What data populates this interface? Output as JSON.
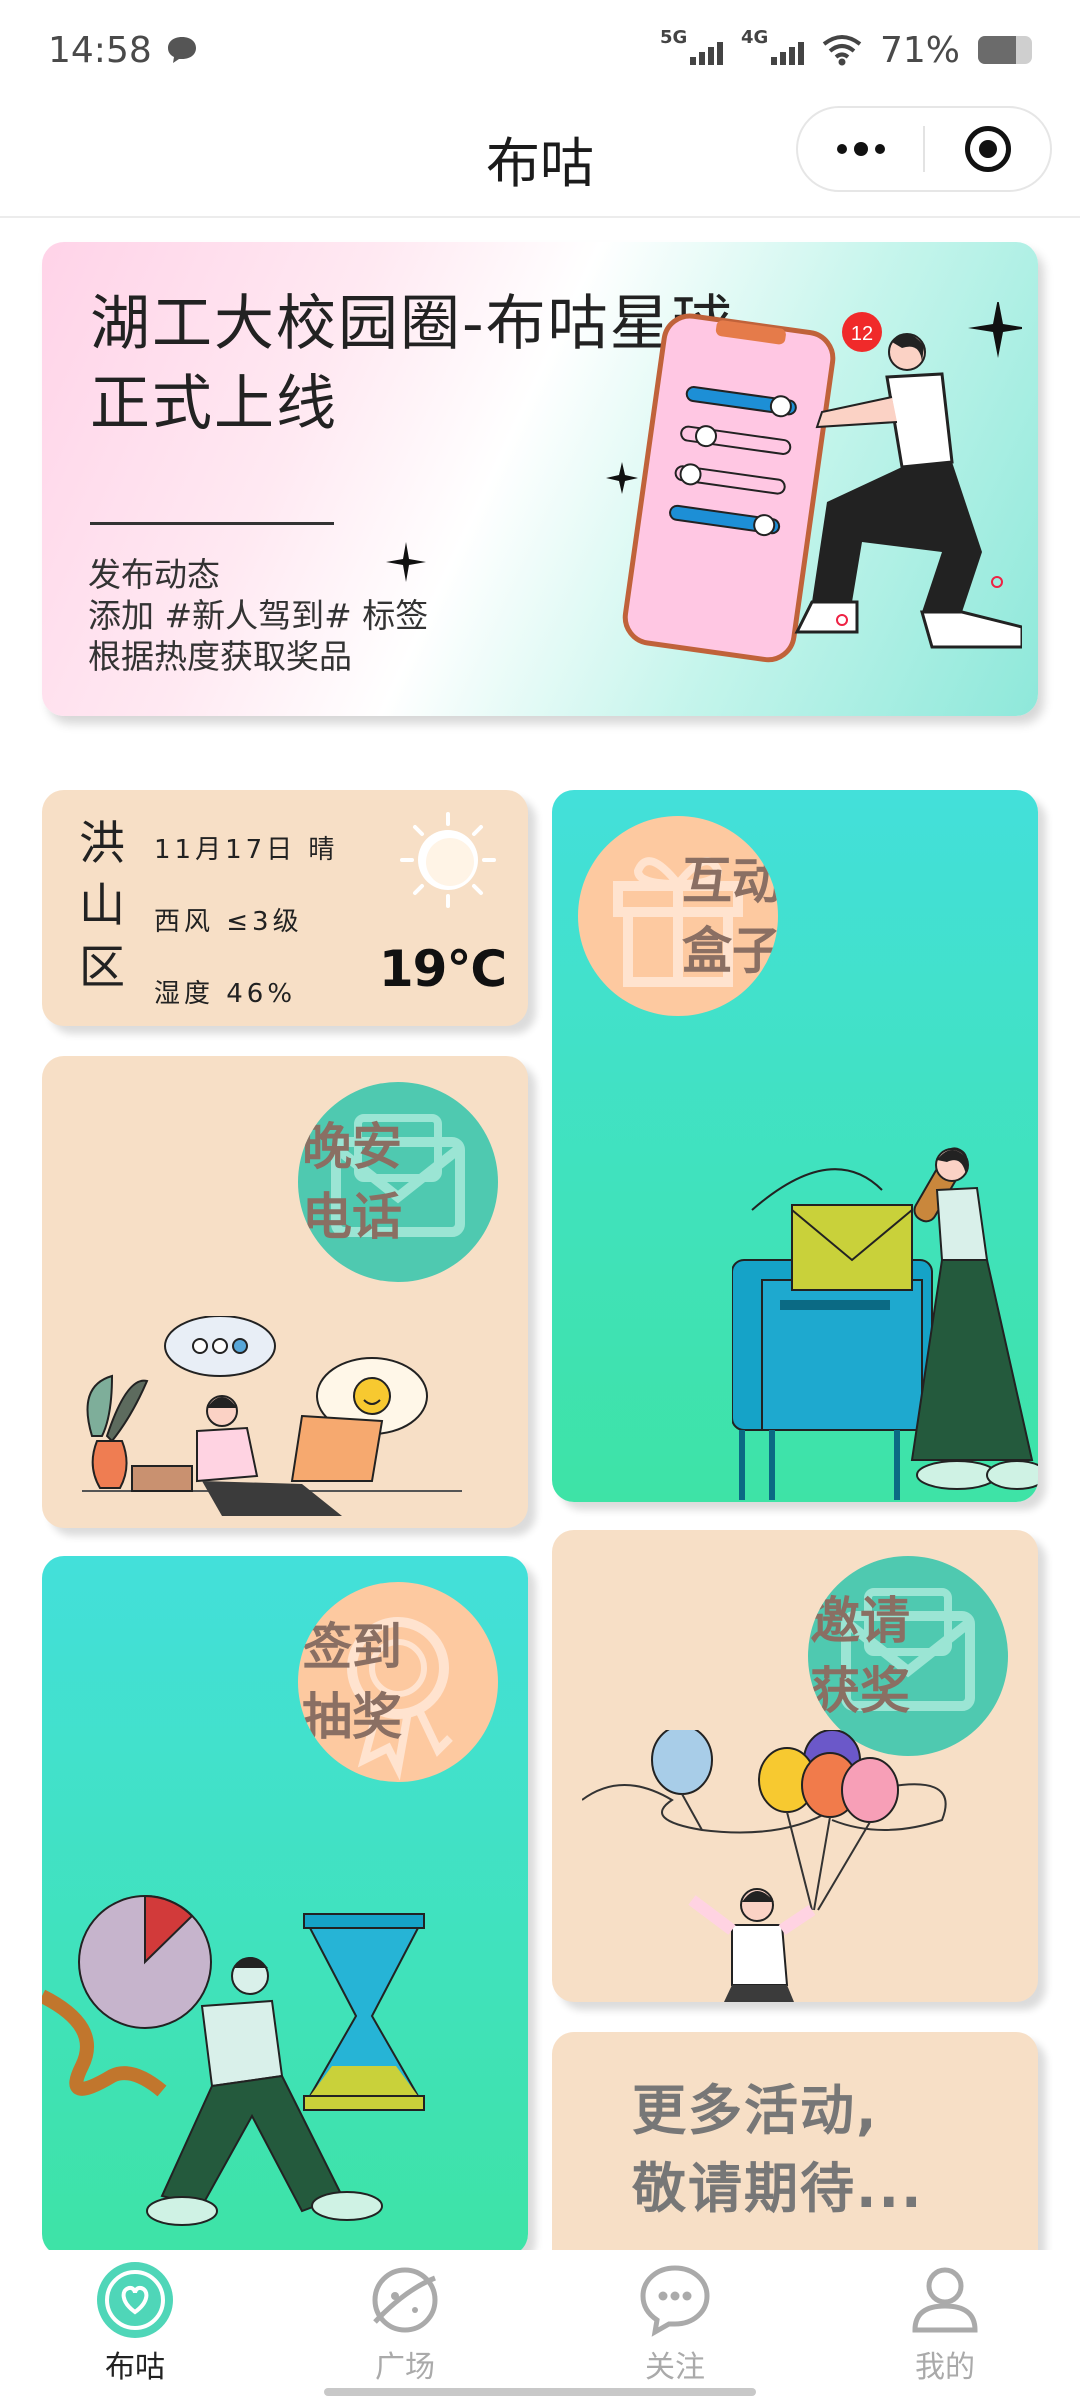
{
  "status": {
    "time": "14:58",
    "net1": "5G",
    "net2": "4G",
    "battery": "71%"
  },
  "nav": {
    "title": "布咕"
  },
  "banner": {
    "title_line1": "湖工大校园圈-布咕星球",
    "title_line2": "正式上线",
    "desc": [
      "发布动态",
      "添加 #新人驾到# 标签",
      "根据热度获取奖品"
    ],
    "badge": "12"
  },
  "weather": {
    "location": [
      "洪",
      "山",
      "区"
    ],
    "date": "11月17日 晴",
    "wind": "西风 ≤3级",
    "humidity": "湿度 46%",
    "temp": "19℃"
  },
  "cards": {
    "goodnight": "晚安\n电话",
    "box": "互动\n盒子",
    "sign": "签到\n抽奖",
    "invite": "邀请\n获奖",
    "more_line1": "更多活动,",
    "more_line2": "敬请期待..."
  },
  "tabs": [
    {
      "label": "布咕",
      "active": true
    },
    {
      "label": "广场",
      "active": false
    },
    {
      "label": "关注",
      "active": false
    },
    {
      "label": "我的",
      "active": false
    }
  ],
  "colors": {
    "peach": "#f7dfc6",
    "teal_top": "#43e0da",
    "teal_bottom": "#3ee3a6",
    "accent": "#4fd6b8"
  }
}
